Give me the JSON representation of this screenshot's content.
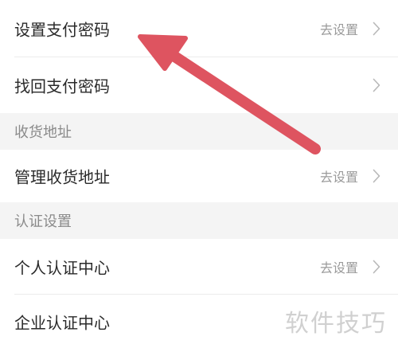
{
  "rows": [
    {
      "label": "设置支付密码",
      "value": "去设置"
    },
    {
      "label": "找回支付密码",
      "value": ""
    },
    {
      "label": "管理收货地址",
      "value": "去设置"
    },
    {
      "label": "个人认证中心",
      "value": "去设置"
    },
    {
      "label": "企业认证中心",
      "value": ""
    }
  ],
  "sections": [
    {
      "title": "收货地址"
    },
    {
      "title": "认证设置"
    }
  ],
  "annotation": {
    "arrow_color": "#de5460",
    "watermark": "软件技巧"
  },
  "colors": {
    "background": "#ffffff",
    "section_background": "#f4f4f4",
    "label_text": "#2a2a2a",
    "muted_text": "#9a9a9a",
    "chevron": "#b8b8b8"
  }
}
